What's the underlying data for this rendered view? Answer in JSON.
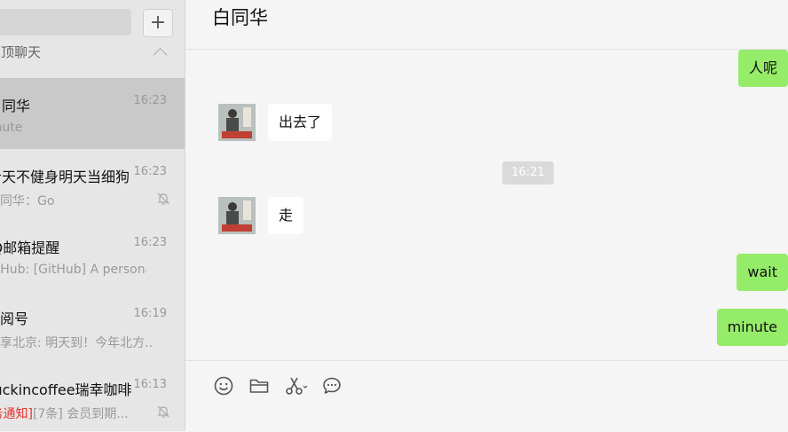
{
  "sidebar": {
    "add_label": "+",
    "group_label": "置顶聊天",
    "chats": [
      {
        "title": "白同华",
        "time": "16:23",
        "preview": "minute",
        "notice": "",
        "muted": false,
        "selected": true
      },
      {
        "title": "今天不健身明天当细狗",
        "time": "16:23",
        "preview": "白同华：Go",
        "notice": "",
        "muted": true,
        "selected": false
      },
      {
        "title": "QQ邮箱提醒",
        "time": "16:23",
        "preview": "GitHub: [GitHub] A personal ...",
        "notice": "",
        "muted": false,
        "selected": false
      },
      {
        "title": "订阅号",
        "time": "16:19",
        "preview": "乐享北京: 明天到！今年北方...",
        "notice": "",
        "muted": false,
        "selected": false
      },
      {
        "title": "luckincoffee瑞幸咖啡",
        "time": "16:13",
        "preview": "[7条] 会员到期...",
        "notice": "[服务通知]",
        "muted": true,
        "selected": false
      }
    ]
  },
  "main": {
    "contact_name": "白同华",
    "messages": [
      {
        "text": "人呢",
        "direction": "out"
      },
      {
        "text": "出去了",
        "direction": "in"
      },
      {
        "time_divider": "16:21"
      },
      {
        "text": "走",
        "direction": "in"
      },
      {
        "text": "wait",
        "direction": "out"
      },
      {
        "text": "minute",
        "direction": "out"
      }
    ]
  },
  "toolbar": {
    "icons": [
      "emoji-icon",
      "folder-icon",
      "scissors-icon",
      "chat-history-icon"
    ]
  },
  "colors": {
    "outgoing_bubble": "#95ec69",
    "incoming_bubble": "#ffffff",
    "selected_chat": "#c9c9c9",
    "notice_red": "#e5332c"
  }
}
